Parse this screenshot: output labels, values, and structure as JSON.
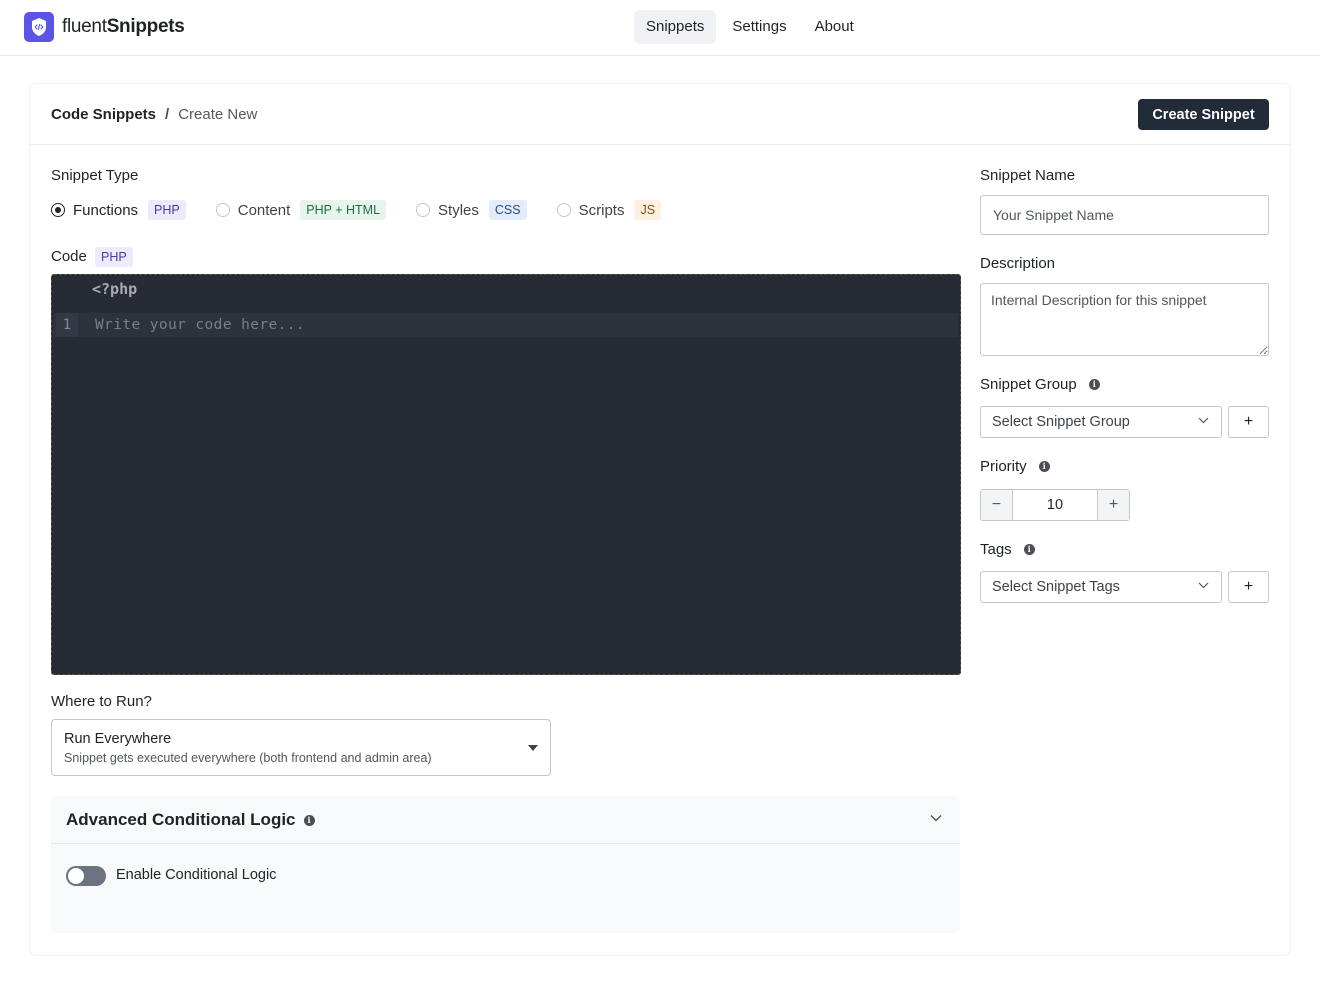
{
  "brand": {
    "name_light": "fluent",
    "name_bold": "Snippets"
  },
  "nav": {
    "items": [
      {
        "label": "Snippets",
        "active": true
      },
      {
        "label": "Settings"
      },
      {
        "label": "About"
      }
    ]
  },
  "breadcrumb": {
    "root": "Code Snippets",
    "separator": "/",
    "current": "Create New"
  },
  "actions": {
    "create_label": "Create Snippet"
  },
  "snippet_type": {
    "label": "Snippet Type",
    "options": [
      {
        "label": "Functions",
        "badge": "PHP",
        "selected": true
      },
      {
        "label": "Content",
        "badge": "PHP + HTML",
        "selected": false
      },
      {
        "label": "Styles",
        "badge": "CSS",
        "selected": false
      },
      {
        "label": "Scripts",
        "badge": "JS",
        "selected": false
      }
    ]
  },
  "code": {
    "label": "Code",
    "badge": "PHP",
    "header_line": "<?php",
    "line_number": "1",
    "placeholder": "Write your code here..."
  },
  "where_to_run": {
    "label": "Where to Run?",
    "selected_title": "Run Everywhere",
    "selected_desc": "Snippet gets executed everywhere (both frontend and admin area)"
  },
  "advanced": {
    "title": "Advanced Conditional Logic",
    "toggle_label": "Enable Conditional Logic",
    "toggle_on": false
  },
  "sidebar": {
    "name_label": "Snippet Name",
    "name_placeholder": "Your Snippet Name",
    "description_label": "Description",
    "description_placeholder": "Internal Description for this snippet",
    "group_label": "Snippet Group",
    "group_placeholder": "Select Snippet Group",
    "priority_label": "Priority",
    "priority_value": "10",
    "tags_label": "Tags",
    "tags_placeholder": "Select Snippet Tags",
    "add_symbol": "+",
    "decrement_symbol": "−",
    "increment_symbol": "+"
  },
  "colors": {
    "brand": "#5b54e6",
    "primary_button": "#222b38",
    "editor_bg": "#272b34"
  }
}
